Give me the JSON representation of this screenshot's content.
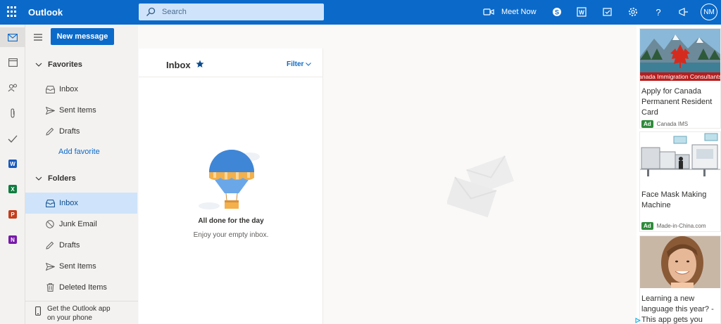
{
  "app": {
    "name": "Outlook",
    "initials": "NM"
  },
  "colors": {
    "brand": "#0b6ac9",
    "selected": "#cfe4fa",
    "ad_badge": "#2e8b3a"
  },
  "topbar": {
    "search_placeholder": "Search",
    "meet_now": "Meet Now",
    "icons": [
      "waffle-icon",
      "search-icon",
      "video-icon",
      "skype-icon",
      "word-icon",
      "todo-icon",
      "gear-icon",
      "help-icon",
      "megaphone-icon"
    ]
  },
  "rail": {
    "items": [
      "mail-icon",
      "calendar-icon",
      "people-icon",
      "attachment-icon",
      "tasks-icon",
      "word-icon",
      "excel-icon",
      "powerpoint-icon",
      "onenote-icon"
    ]
  },
  "folder_pane": {
    "new_message": "New message",
    "favorites": {
      "title": "Favorites",
      "items": [
        "Inbox",
        "Sent Items",
        "Drafts"
      ],
      "add_favorite": "Add favorite"
    },
    "folders": {
      "title": "Folders",
      "items": [
        "Inbox",
        "Junk Email",
        "Drafts",
        "Sent Items",
        "Deleted Items"
      ],
      "selected": "Inbox"
    },
    "get_app_line1": "Get the Outlook app",
    "get_app_line2": "on your phone"
  },
  "message_list": {
    "title": "Inbox",
    "filter": "Filter",
    "empty_title": "All done for the day",
    "empty_subtitle": "Enjoy your empty inbox."
  },
  "ads": [
    {
      "banner": "anada Immigration Consultants",
      "text": "Apply for Canada Permanent Resident Card",
      "badge": "Ad",
      "source": "Canada IMS"
    },
    {
      "text": "Face Mask Making Machine",
      "badge": "Ad",
      "source": "Made-in-China.com"
    },
    {
      "text": "Learning a new language this year? - This app gets you"
    }
  ]
}
